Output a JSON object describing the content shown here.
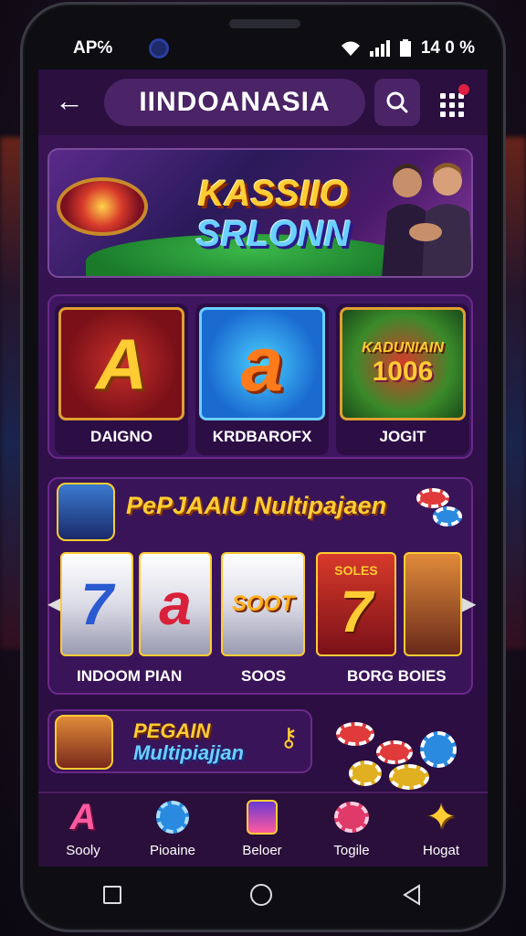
{
  "status_bar": {
    "left_text": "AP℅",
    "right_text": "14 0 %"
  },
  "app_bar": {
    "title": "IINDOANASIA"
  },
  "hero": {
    "title_line1": "KASSIIO",
    "title_line2": "SRLONN"
  },
  "categories": [
    {
      "label": "DAIGNO",
      "art_text": "A"
    },
    {
      "label": "KRDBAROFX",
      "art_text": "a"
    },
    {
      "label": "JOGIT",
      "art_text_1": "KADUNIAIN",
      "art_text_2": "1006"
    }
  ],
  "slot_section": {
    "header": "PePJAAIU Nultipajaen",
    "reels": [
      "7",
      "a",
      "SOOT",
      "7"
    ],
    "reel_top_text": "SOLES",
    "labels": [
      "INDOOM PIAN",
      "SOOS",
      "BORG BOIES"
    ]
  },
  "promo": {
    "line1": "PEGAIN",
    "line2": "Multipiajjan"
  },
  "bottom_nav": [
    {
      "label": "Sooly",
      "icon": "A"
    },
    {
      "label": "Pioaine",
      "icon": "chip"
    },
    {
      "label": "Beloer",
      "icon": "slot"
    },
    {
      "label": "Togile",
      "icon": "chip"
    },
    {
      "label": "Hogat",
      "icon": "star"
    }
  ],
  "colors": {
    "accent_gold": "#ffcc33",
    "accent_blue": "#6ad0ff",
    "background_purple": "#3b1558"
  }
}
